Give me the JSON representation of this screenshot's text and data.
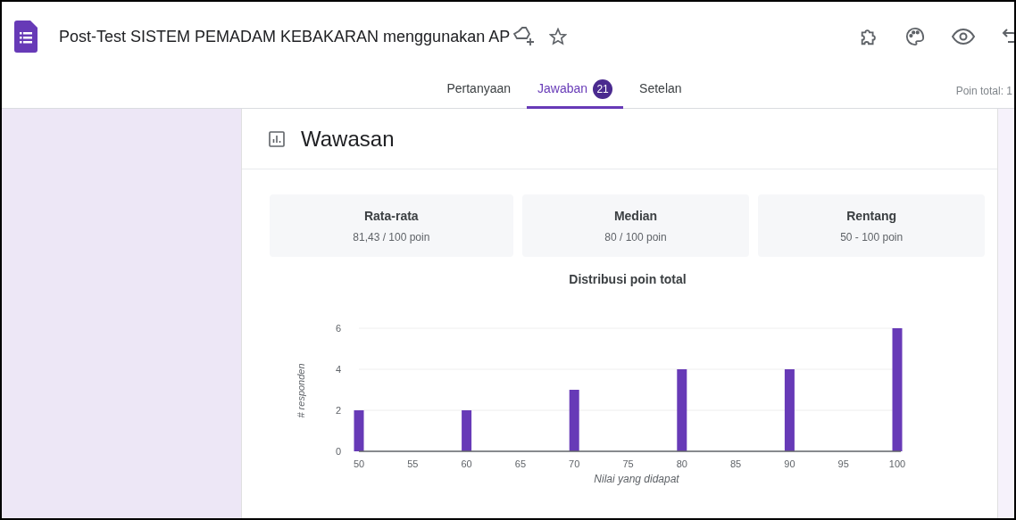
{
  "app": {
    "title": "Post-Test SISTEM PEMADAM KEBAKARAN menggunakan AP"
  },
  "tabs": [
    {
      "label": "Pertanyaan",
      "selected": false
    },
    {
      "label": "Jawaban",
      "selected": true,
      "badge": "21"
    },
    {
      "label": "Setelan",
      "selected": false
    }
  ],
  "total_points": "Poin total: 1",
  "insights": {
    "title": "Wawasan",
    "stats": [
      {
        "label": "Rata-rata",
        "value": "81,43 / 100 poin"
      },
      {
        "label": "Median",
        "value": "80 / 100 poin"
      },
      {
        "label": "Rentang",
        "value": "50 - 100 poin"
      }
    ],
    "chart_data": {
      "type": "bar",
      "title": "Distribusi poin total",
      "xlabel": "Nilai yang didapat",
      "ylabel": "# responden",
      "x": [
        50,
        60,
        70,
        80,
        90,
        100
      ],
      "series": [
        {
          "color": "#673ab7",
          "values": [
            2,
            2,
            3,
            4,
            4,
            6
          ]
        }
      ],
      "xlim": [
        50,
        100
      ],
      "ylim": [
        0,
        6
      ],
      "xticks": [
        50,
        55,
        60,
        65,
        70,
        75,
        80,
        85,
        90,
        95,
        100
      ],
      "yticks": [
        0,
        2,
        4,
        6
      ]
    }
  }
}
